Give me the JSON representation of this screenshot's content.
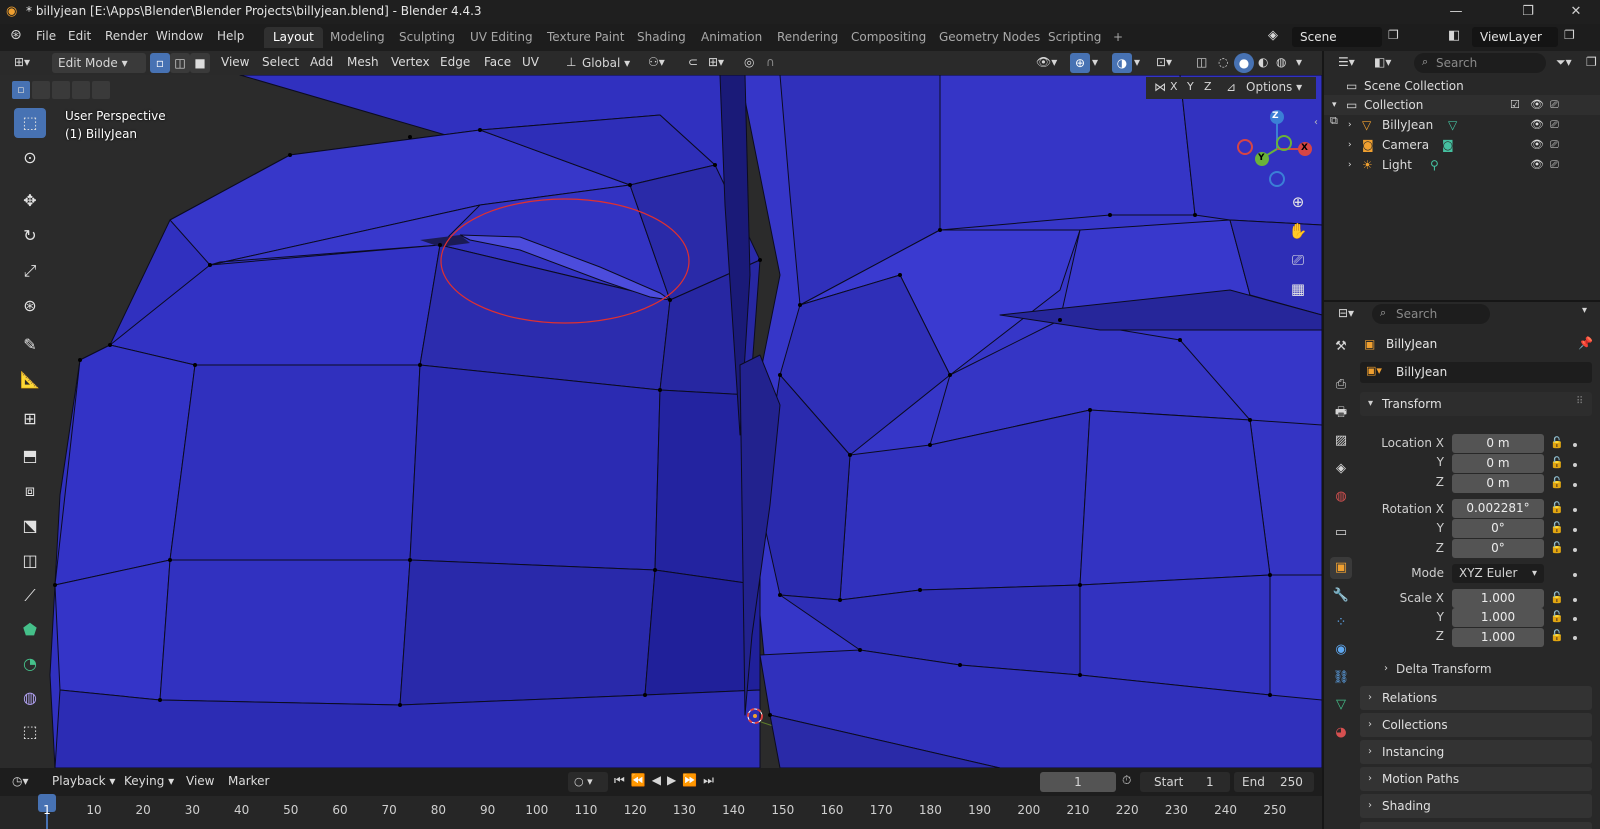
{
  "window": {
    "title": "* billyjean [E:\\Apps\\Blender\\Blender Projects\\billyjean.blend] - Blender 4.4.3",
    "controls": [
      "minimize-icon",
      "maximize-icon",
      "close-icon"
    ]
  },
  "menubar": {
    "items": [
      "File",
      "Edit",
      "Render",
      "Window",
      "Help"
    ],
    "workspaces": [
      "Layout",
      "Modeling",
      "Sculpting",
      "UV Editing",
      "Texture Paint",
      "Shading",
      "Animation",
      "Rendering",
      "Compositing",
      "Geometry Nodes",
      "Scripting"
    ],
    "active_workspace": "Layout",
    "add_workspace": "+",
    "scene": "Scene",
    "view_layer": "ViewLayer"
  },
  "viewport_header": {
    "mode": "Edit Mode",
    "menus": [
      "View",
      "Select",
      "Add",
      "Mesh",
      "Vertex",
      "Edge",
      "Face",
      "UV"
    ],
    "transform_orientation": "Global",
    "axes": [
      "X",
      "Y",
      "Z"
    ],
    "options": "Options"
  },
  "viewport": {
    "perspective": "User Perspective",
    "object_label": "(1) BillyJean",
    "gizmo_axes": [
      "Z",
      "Y",
      "X"
    ],
    "mesh_color": "#3434c8",
    "annotation_color": "#e03030"
  },
  "toolbar": {
    "tools": [
      "select-box-icon",
      "cursor-icon",
      "move-icon",
      "rotate-icon",
      "scale-icon",
      "transform-icon",
      "annotate-icon",
      "measure-icon",
      "add-cube-icon",
      "extrude-icon",
      "inset-icon",
      "bevel-icon",
      "loop-cut-icon",
      "knife-icon",
      "poly-build-icon",
      "spin-icon",
      "smooth-icon",
      "shrink-fatten-icon"
    ]
  },
  "outliner": {
    "search_placeholder": "Search",
    "scene_collection": "Scene Collection",
    "collection": "Collection",
    "objects": [
      {
        "name": "BillyJean",
        "icon": "mesh-icon"
      },
      {
        "name": "Camera",
        "icon": "camera-icon"
      },
      {
        "name": "Light",
        "icon": "light-icon"
      }
    ]
  },
  "properties": {
    "search_placeholder": "Search",
    "object_name": "BillyJean",
    "object_datablock": "BillyJean",
    "transform": {
      "header": "Transform",
      "location_label": "Location X",
      "location": [
        "0 m",
        "0 m",
        "0 m"
      ],
      "rotation_label": "Rotation X",
      "rotation": [
        "0.002281°",
        "0°",
        "0°"
      ],
      "mode_label": "Mode",
      "mode": "XYZ Euler",
      "scale_label": "Scale X",
      "scale": [
        "1.000",
        "1.000",
        "1.000"
      ],
      "y": "Y",
      "z": "Z"
    },
    "subpanels": [
      "Delta Transform"
    ],
    "panels": [
      "Relations",
      "Collections",
      "Instancing",
      "Motion Paths",
      "Shading"
    ]
  },
  "timeline": {
    "menus": [
      "Playback",
      "Keying",
      "View",
      "Marker"
    ],
    "current_frame": "1",
    "start_label": "Start",
    "start": "1",
    "end_label": "End",
    "end": "250",
    "ticks": [
      "1",
      "10",
      "20",
      "30",
      "40",
      "50",
      "60",
      "70",
      "80",
      "90",
      "100",
      "110",
      "120",
      "130",
      "140",
      "150",
      "160",
      "170",
      "180",
      "190",
      "200",
      "210",
      "220",
      "230",
      "240",
      "250"
    ]
  }
}
